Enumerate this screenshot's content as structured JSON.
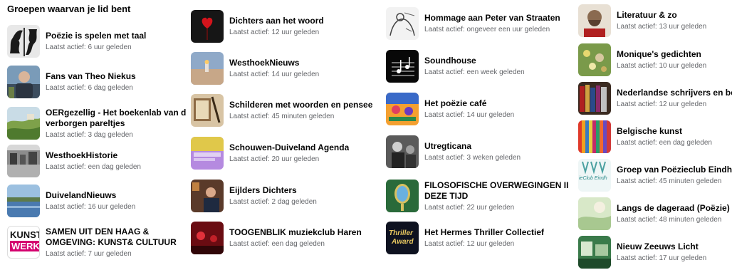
{
  "page": {
    "title": "Groepen waarvan je lid bent"
  },
  "groups": [
    {
      "name": "Poëzie is spelen met taal",
      "activity": "Laatst actief: 6 uur geleden",
      "icon": "faces-silhouette-thumbnail"
    },
    {
      "name": "Fans van Theo Niekus",
      "activity": "Laatst actief: 6 dag geleden",
      "icon": "man-portrait-thumbnail"
    },
    {
      "name": "OERgezellig - Het boekenlab van de verborgen pareltjes",
      "name_line1": "OERgezellig - Het boekenlab van d",
      "name_line2": "verborgen pareltjes",
      "activity": "Laatst actief: 3 dag geleden",
      "icon": "landscape-thumbnail"
    },
    {
      "name": "WesthoekHistorie",
      "activity": "Laatst actief: een dag geleden",
      "icon": "old-photo-thumbnail"
    },
    {
      "name": "DuivelandNieuws",
      "activity": "Laatst actief: 16 uur geleden",
      "icon": "lake-thumbnail"
    },
    {
      "name_line1": "SAMEN UIT DEN HAAG &",
      "name_line2": "OMGEVING: KUNST& CULTUUR",
      "activity": "Laatst actief: 7 uur geleden",
      "icon": "kunstwerk-logo-thumbnail",
      "logo_top": "KUNST",
      "logo_bottom": "WERK"
    },
    {
      "name": "Dichters aan het woord",
      "activity": "Laatst actief: 12 uur geleden",
      "icon": "heart-thumbnail"
    },
    {
      "name": "WesthoekNieuws",
      "activity": "Laatst actief: 14 uur geleden",
      "icon": "lighthouse-thumbnail"
    },
    {
      "name": "Schilderen met woorden en penseel",
      "name_display": "Schilderen met woorden en pensee",
      "activity": "Laatst actief: 45 minuten geleden",
      "icon": "painting-thumbnail"
    },
    {
      "name": "Schouwen-Duiveland Agenda",
      "activity": "Laatst actief: 20 uur geleden",
      "icon": "agenda-thumbnail"
    },
    {
      "name": "Eijlders Dichters",
      "activity": "Laatst actief: 2 dag geleden",
      "icon": "people-thumbnail"
    },
    {
      "name": "TOOGENBLIK muziekclub Haren",
      "activity": "Laatst actief: een dag geleden",
      "icon": "stage-thumbnail"
    },
    {
      "name": "Hommage aan Peter van Straaten",
      "activity": "Laatst actief: ongeveer een uur geleden",
      "icon": "sketch-thumbnail"
    },
    {
      "name": "Soundhouse",
      "activity": "Laatst actief: een week geleden",
      "icon": "music-notes-thumbnail"
    },
    {
      "name": "Het poëzie café",
      "activity": "Laatst actief: 14 uur geleden",
      "icon": "cafe-illustration-thumbnail"
    },
    {
      "name": "Utregticana",
      "activity": "Laatst actief: 3 weken geleden",
      "icon": "bw-photo-thumbnail"
    },
    {
      "name_line1": "FILOSOFISCHE OVERWEGINGEN II",
      "name_line2": "DEZE TIJD",
      "activity": "Laatst actief: 22 uur geleden",
      "icon": "mirror-thumbnail"
    },
    {
      "name": "Het Hermes Thriller Collectief",
      "activity": "Laatst actief: 12 uur geleden",
      "icon": "thriller-award-thumbnail",
      "logo_top": "Thriller",
      "logo_bottom": "Award"
    },
    {
      "name": "Literatuur & zo",
      "activity": "Laatst actief: 13 uur geleden",
      "icon": "writer-portrait-thumbnail"
    },
    {
      "name": "Monique's gedichten",
      "activity": "Laatst actief: 10 uur geleden",
      "icon": "flowers-thumbnail"
    },
    {
      "name": "Nederlandse schrijvers en boeken",
      "name_display": "Nederlandse schrijvers en boeke",
      "activity": "Laatst actief: 12 uur geleden",
      "icon": "books-thumbnail"
    },
    {
      "name": "Belgische kunst",
      "activity": "Laatst actief: een dag geleden",
      "icon": "stripes-thumbnail"
    },
    {
      "name": "Groep van Poëzieclub Eindhoven",
      "name_display": "Groep van Poëzieclub Eindhoven",
      "activity": "Laatst actief: 45 minuten geleden",
      "icon": "poezieclub-logo-thumbnail",
      "logo_top": "ieClub Eindh"
    },
    {
      "name": "Langs de dageraad (Poëzie)",
      "activity": "Laatst actief: 48 minuten geleden",
      "icon": "dawn-thumbnail"
    },
    {
      "name": "Nieuw Zeeuws Licht",
      "activity": "Laatst actief: 17 uur geleden",
      "icon": "green-photo-thumbnail"
    }
  ],
  "colors": {
    "name_text": "#050505",
    "meta_text": "#65676b",
    "background": "#ffffff",
    "kunstwerk_magenta": "#d4006e"
  }
}
